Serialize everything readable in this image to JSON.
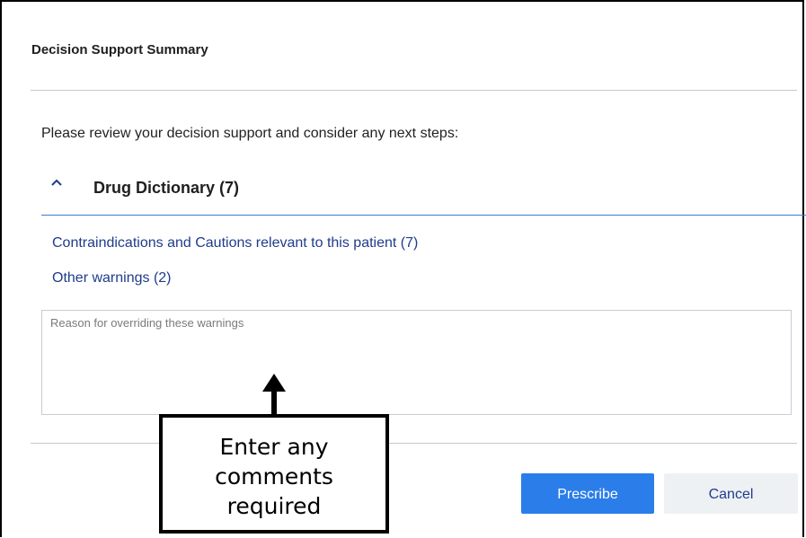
{
  "dialog": {
    "title": "Decision Support Summary",
    "intro": "Please review your decision support and consider any next steps:"
  },
  "section": {
    "icon": "chevron-up-icon",
    "title": "Drug Dictionary (7)",
    "expanded": true,
    "links": [
      "Contraindications and Cautions relevant to this patient (7)",
      "Other warnings (2)"
    ]
  },
  "reason_field": {
    "value": "",
    "placeholder": "Reason for overriding these warnings"
  },
  "buttons": {
    "prescribe": "Prescribe",
    "cancel": "Cancel"
  },
  "annotation": {
    "lines": [
      "Enter any",
      "comments",
      "required"
    ]
  },
  "colors": {
    "accent": "#2b7de9",
    "link": "#1f3c8a",
    "section_rule": "#3a7bd5",
    "cancel_bg": "#eef1f4"
  }
}
